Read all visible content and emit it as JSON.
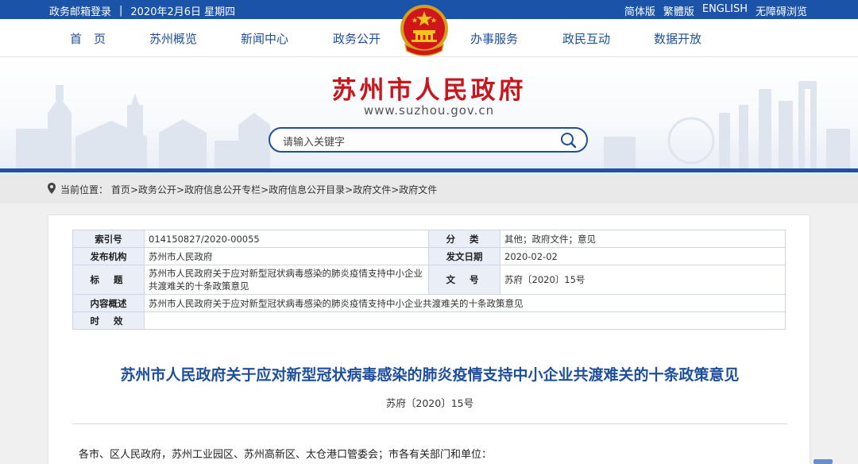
{
  "topbar": {
    "mail_login": "政务邮箱登录",
    "separator": "|",
    "date": "2020年2月6日 星期四",
    "lang_simplified": "简体版",
    "lang_traditional": "繁體版",
    "lang_english": "ENGLISH",
    "accessibility": "无障碍浏览"
  },
  "nav": {
    "items": [
      "首　页",
      "苏州概览",
      "新闻中心",
      "政务公开",
      "办事服务",
      "政民互动",
      "数据开放"
    ]
  },
  "banner": {
    "title": "苏州市人民政府",
    "url": "www.suzhou.gov.cn"
  },
  "search": {
    "placeholder": "请输入关键字",
    "icon": "search-icon"
  },
  "breadcrumb": {
    "label": "当前位置：",
    "path": "首页>政务公开>政府信息公开专栏>政府信息公开目录>政府文件>政府文件"
  },
  "meta": {
    "index_label": "索引号",
    "index_value": "014150827/2020-00055",
    "category_label": "分类",
    "category_value": "其他；政府文件；意见",
    "issuer_label": "发布机构",
    "issuer_value": "苏州市人民政府",
    "date_label": "发文日期",
    "date_value": "2020-02-02",
    "title_label": "标题",
    "title_value": "苏州市人民政府关于应对新型冠状病毒感染的肺炎疫情支持中小企业共渡难关的十条政策意见",
    "docno_label": "文号",
    "docno_value": "苏府〔2020〕15号",
    "summary_label": "内容概述",
    "summary_value": "苏州市人民政府关于应对新型冠状病毒感染的肺炎疫情支持中小企业共渡难关的十条政策意见",
    "validity_label": "时效",
    "validity_value": ""
  },
  "document": {
    "title": "苏州市人民政府关于应对新型冠状病毒感染的肺炎疫情支持中小企业共渡难关的十条政策意见",
    "number": "苏府〔2020〕15号",
    "salutation": "各市、区人民政府，苏州工业园区、苏州高新区、太仓港口管委会；市各有关部门和单位："
  },
  "colors": {
    "brand_blue": "#1a53a8",
    "title_red": "#c8161d",
    "nav_text": "#1d4f9c"
  }
}
